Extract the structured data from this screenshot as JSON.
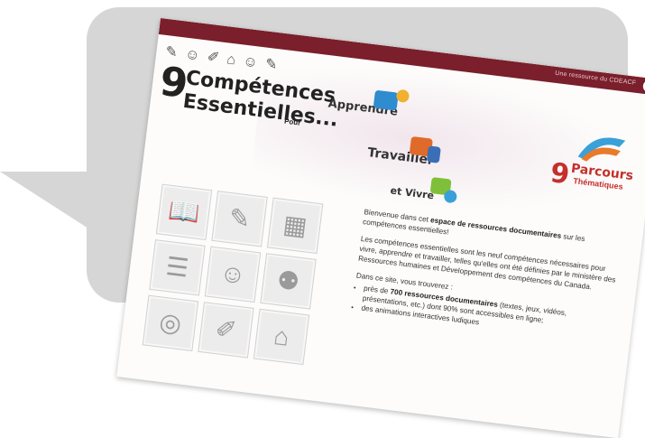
{
  "page": {
    "topbar": {
      "link": "Une ressource du CDEACF",
      "logo": "C"
    },
    "header": {
      "title_number": "9",
      "title_line1": "Compétences",
      "title_line2": "Essentielles...",
      "title_pour": "Pour",
      "verbs": [
        "Apprendre",
        "Travailler",
        "et Vivre"
      ],
      "parcours": {
        "number": "9",
        "line1": "Parcours",
        "line2": "Thématiques"
      }
    },
    "icons": [
      {
        "name": "open-book-icon",
        "glyph": "📖"
      },
      {
        "name": "pencil-icon",
        "glyph": "✎"
      },
      {
        "name": "calculator-icon",
        "glyph": "▦"
      },
      {
        "name": "document-icon",
        "glyph": "☰"
      },
      {
        "name": "people-talking-icon",
        "glyph": "☺"
      },
      {
        "name": "group-icon",
        "glyph": "⚉"
      },
      {
        "name": "computer-icon",
        "glyph": "◎"
      },
      {
        "name": "thinking-icon",
        "glyph": "✐"
      },
      {
        "name": "learning-icon",
        "glyph": "⌂"
      }
    ],
    "intro": {
      "welcome_pre": "Bienvenue dans cet ",
      "welcome_bold": "espace de ressources documentaires",
      "welcome_post": " sur les compétences essentielles!",
      "para2": "Les compétences essentielles sont les neuf compétences nécessaires pour vivre, apprendre et travailler, telles qu'elles ont été définies par le ministère des Ressources humaines et Développement des compétences du Canada.",
      "list_intro": "Dans ce site, vous trouverez :",
      "bullet1_pre": "près de ",
      "bullet1_bold": "700 ressources documentaires",
      "bullet1_post": " (textes, jeux, vidéos, présentations, etc.) dont 90% sont accessibles en ligne;",
      "bullet2": "des animations interactives ludiques"
    }
  }
}
